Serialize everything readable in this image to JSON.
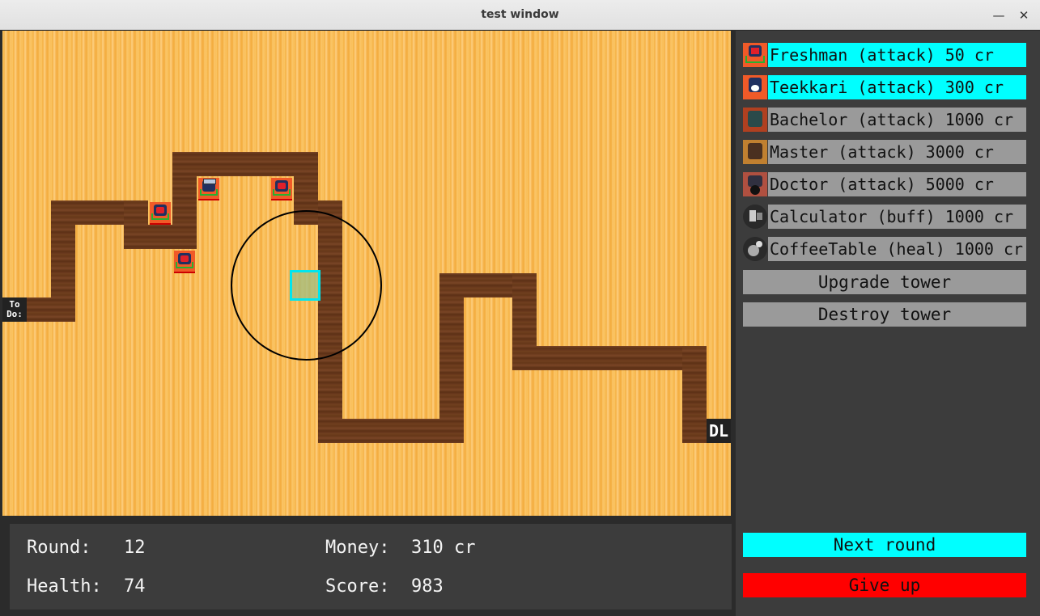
{
  "window": {
    "title": "test window",
    "minimize_icon": "minimize-icon",
    "close_icon": "close-icon"
  },
  "map": {
    "start_label": "To Do:",
    "end_label": "DL"
  },
  "shop": [
    {
      "label": "Freshman (attack) 50 cr",
      "icon": "freshman-icon",
      "affordable": true
    },
    {
      "label": "Teekkari (attack) 300 cr",
      "icon": "teekkari-icon",
      "affordable": true
    },
    {
      "label": "Bachelor (attack) 1000 cr",
      "icon": "bachelor-icon",
      "affordable": false
    },
    {
      "label": "Master (attack) 3000 cr",
      "icon": "master-icon",
      "affordable": false
    },
    {
      "label": "Doctor (attack) 5000 cr",
      "icon": "doctor-icon",
      "affordable": false
    },
    {
      "label": "Calculator (buff) 1000 cr",
      "icon": "calculator-icon",
      "affordable": false
    },
    {
      "label": "CoffeeTable (heal) 1000 cr",
      "icon": "coffee-table-icon",
      "affordable": false
    }
  ],
  "actions": {
    "upgrade": "Upgrade tower",
    "destroy": "Destroy tower",
    "next_round": "Next round",
    "give_up": "Give up"
  },
  "stats": {
    "round_label": "Round:",
    "round_value": "12",
    "health_label": "Health:",
    "health_value": "74",
    "money_label": "Money:",
    "money_value": "310 cr",
    "score_label": "Score:",
    "score_value": "983"
  },
  "colors": {
    "affordable": "#00ffff",
    "unaffordable": "#9a9a9a",
    "give_up": "#ff0000",
    "path": "#6b3b1e",
    "field": "#f8b94e"
  }
}
